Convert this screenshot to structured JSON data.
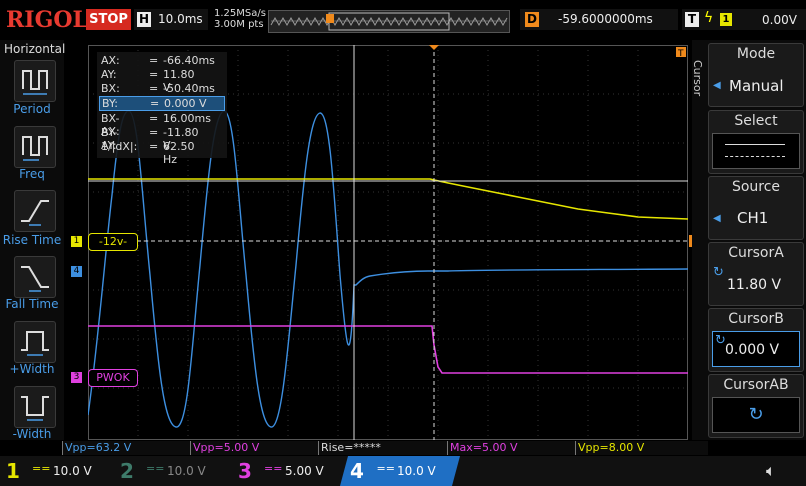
{
  "brand": {
    "name": "RIGOL"
  },
  "run_state": "STOP",
  "horizontal": {
    "letter": "H",
    "scale": "10.0ms",
    "sample_rate": "1.25MSa/s",
    "points": "3.00M pts"
  },
  "delay": {
    "letter": "D",
    "value": "-59.6000000ms"
  },
  "trigger": {
    "letter": "T",
    "source": "1",
    "level": "0.00V"
  },
  "left_menu": {
    "title": "Horizontal",
    "items": [
      {
        "label": "Period"
      },
      {
        "label": "Freq"
      },
      {
        "label": "Rise Time"
      },
      {
        "label": "Fall Time"
      },
      {
        "label": "+Width"
      },
      {
        "label": "-Width"
      }
    ]
  },
  "cursor_readout": [
    {
      "name": "AX:",
      "eq": "=",
      "value": "-66.40ms"
    },
    {
      "name": "AY:",
      "eq": "=",
      "value": "11.80 V"
    },
    {
      "name": "BX:",
      "eq": "=",
      "value": "-50.40ms"
    },
    {
      "name": "BY:",
      "eq": "=",
      "value": "0.000 V"
    },
    {
      "name": "BX-AX:",
      "eq": "=",
      "value": "16.00ms"
    },
    {
      "name": "BY-AY:",
      "eq": "=",
      "value": "-11.80 V"
    },
    {
      "name": "1/|dX|:",
      "eq": "=",
      "value": "62.50 Hz"
    }
  ],
  "grid_labels": {
    "ch1_marker": "1",
    "ch1_level_tag": "-12v-",
    "ch4_marker": "4",
    "ch3_marker": "3",
    "ch3_label": "PWOK",
    "trig_marker": "T"
  },
  "right_menu": {
    "side_label": "Cursor",
    "mode": {
      "title": "Mode",
      "value": "Manual"
    },
    "select": {
      "title": "Select"
    },
    "source": {
      "title": "Source",
      "value": "CH1"
    },
    "cursor_a": {
      "title": "CursorA",
      "value": "11.80 V"
    },
    "cursor_b": {
      "title": "CursorB",
      "value": "0.000 V"
    },
    "cursor_ab": {
      "title": "CursorAB"
    }
  },
  "measurements": [
    {
      "text": "Vpp=63.2 V",
      "color": "#4a9de8"
    },
    {
      "text": "Vpp=5.00 V",
      "color": "#e040e0"
    },
    {
      "text": "Rise=*****",
      "color": "#dddddd"
    },
    {
      "text": "Max=5.00 V",
      "color": "#e040e0"
    },
    {
      "text": "Vpp=8.00 V",
      "color": "#e6e600"
    }
  ],
  "channels": [
    {
      "num": "1",
      "coupling": "==",
      "scale": "10.0 V",
      "color": "#e6e600"
    },
    {
      "num": "2",
      "coupling": "==",
      "scale": "10.0 V",
      "color": "#3e7b6a"
    },
    {
      "num": "3",
      "coupling": "==",
      "scale": "5.00 V",
      "color": "#e040e0"
    },
    {
      "num": "4",
      "coupling": "==",
      "scale": "10.0 V",
      "color": "#ffffff"
    }
  ],
  "colors": {
    "ch1": "#e6e600",
    "ch3": "#e040e0",
    "ch4": "#3d8fe0",
    "accent": "#f08a1c",
    "stop": "#d62a20"
  }
}
